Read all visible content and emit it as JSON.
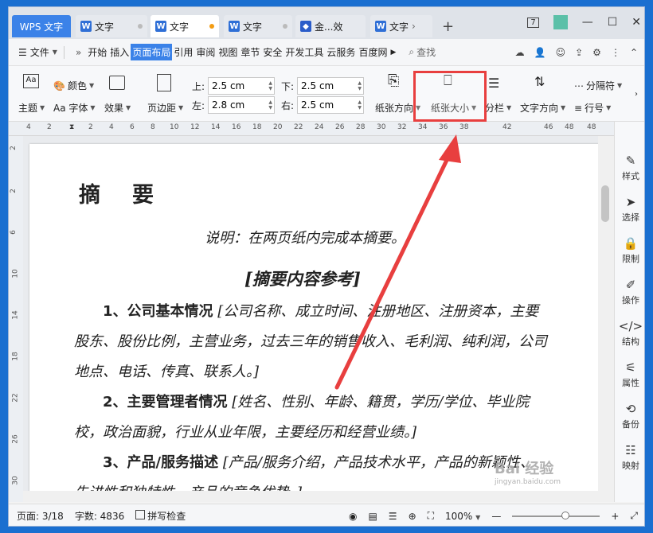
{
  "titlebar": {
    "app_tab": "WPS 文字",
    "tabs": [
      {
        "label": "文字"
      },
      {
        "label": "文字"
      },
      {
        "label": "文字"
      },
      {
        "label": "金...效"
      },
      {
        "label": "文字"
      }
    ],
    "badge": "7"
  },
  "menubar": {
    "file": "文件",
    "items": [
      "开始",
      "插入",
      "页面布局",
      "引用",
      "审阅",
      "视图",
      "章节",
      "安全",
      "开发工具",
      "云服务",
      "百度网"
    ],
    "active": "页面布局",
    "search": "查找"
  },
  "ribbon": {
    "theme": "主题",
    "color": "颜色",
    "font": "Aa 字体",
    "effect": "效果",
    "margins": "页边距",
    "top_label": "上:",
    "top_value": "2.5 cm",
    "left_label": "左:",
    "left_value": "2.8 cm",
    "bottom_label": "下:",
    "bottom_value": "2.5 cm",
    "right_label": "右:",
    "right_value": "2.5 cm",
    "orientation": "纸张方向",
    "size": "纸张大小",
    "columns": "分栏",
    "text_direction": "文字方向",
    "separator": "分隔符",
    "line_number": "行号"
  },
  "ruler": {
    "ticks": [
      "4",
      "2",
      "",
      "2",
      "4",
      "6",
      "8",
      "10",
      "12",
      "14",
      "16",
      "18",
      "20",
      "22",
      "24",
      "26",
      "28",
      "30",
      "32",
      "34",
      "36",
      "38",
      "",
      "42",
      "",
      "46",
      "48"
    ]
  },
  "document": {
    "heading": "摘要",
    "note": "说明：在两页纸内完成本摘要。",
    "reference": "[摘要内容参考]",
    "p1_bold": "1、公司基本情况",
    "p1_line1": "[公司名称、成立时间、注册地区、注册资本，主要",
    "p1_line2": "股东、股份比例，主营业务，过去三年的销售收入、毛利润、纯利润，公司",
    "p1_line3": "地点、电话、传真、联系人。]",
    "p2_bold": "2、主要管理者情况",
    "p2_line1": "[姓名、性别、年龄、籍贯，学历/学位、毕业院",
    "p2_line2": "校，政治面貌，行业从业年限，主要经历和经营业绩。]",
    "p3_bold": "3、产品/服务描述",
    "p3_line1": "[产品/服务介绍，产品技术水平，产品的新颖性、",
    "p3_line2": "先进性和独特性，产品的竞争优势。]"
  },
  "rpanel": [
    "样式",
    "选择",
    "限制",
    "操作",
    "结构",
    "属性",
    "备份",
    "映射"
  ],
  "statusbar": {
    "page": "页面: 3/18",
    "words": "字数: 4836",
    "spell": "拼写检查",
    "zoom": "100%"
  },
  "watermark": "Bai 经验",
  "watermark_sub": "jingyan.baidu.com",
  "colors": {
    "accent": "#3b82e8",
    "annotation": "#e83f3f"
  }
}
